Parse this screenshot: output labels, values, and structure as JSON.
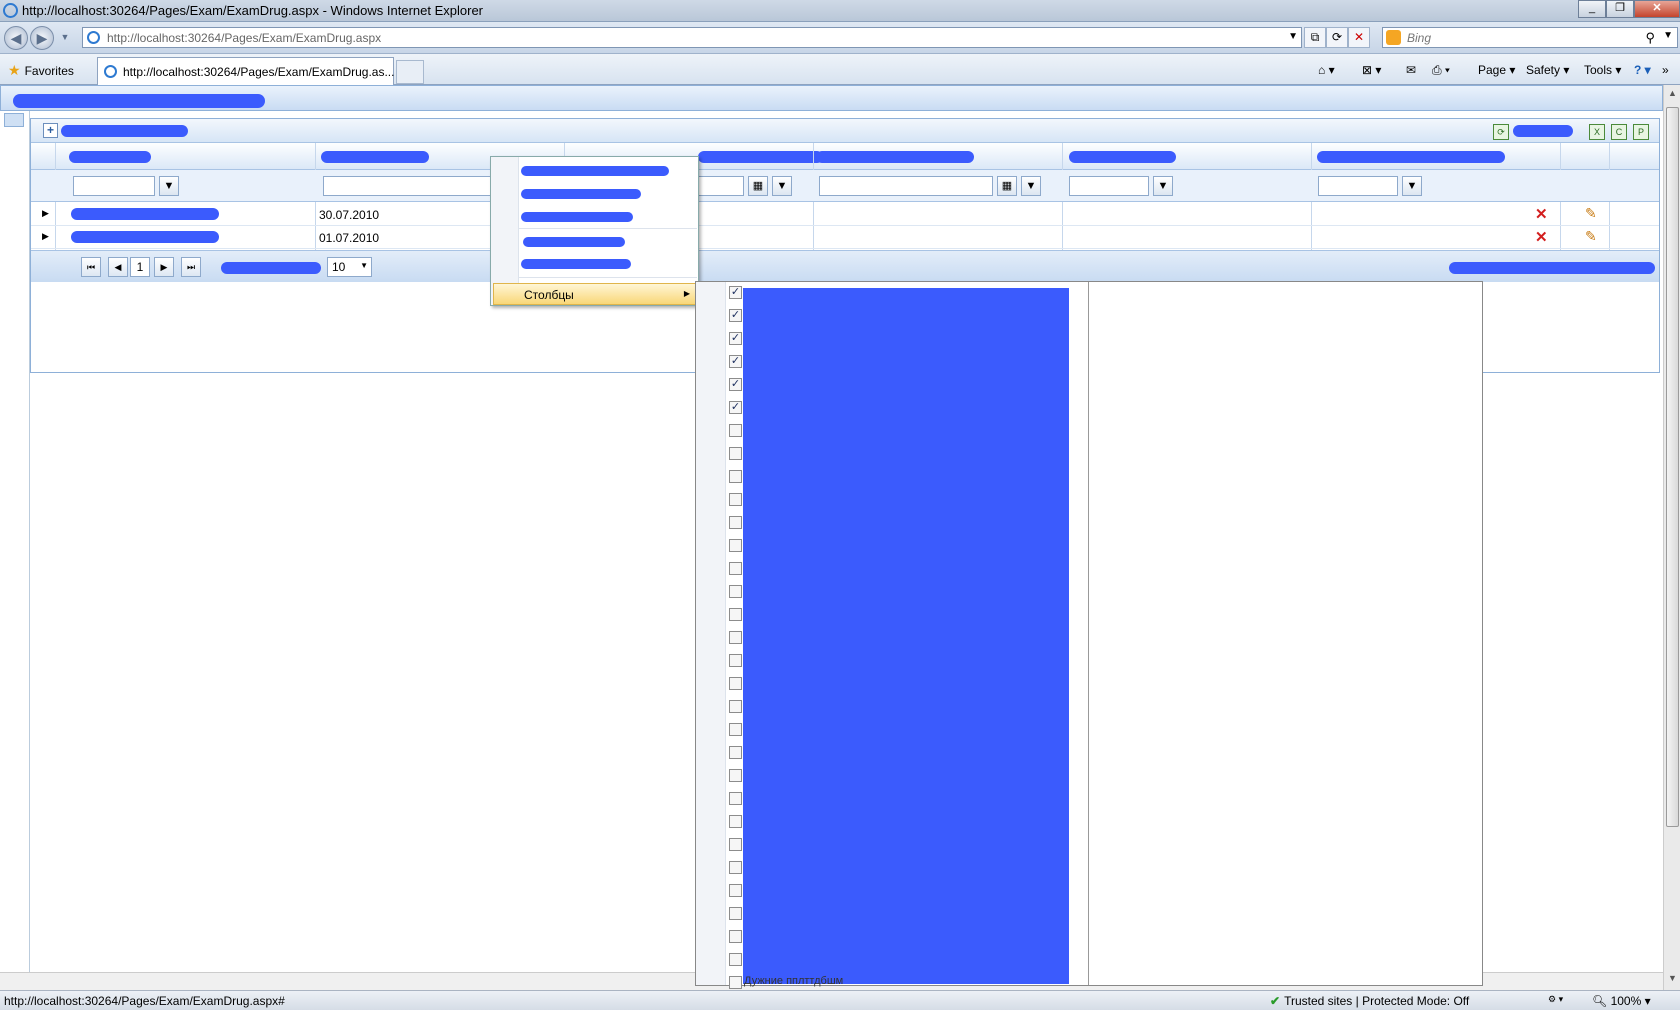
{
  "window": {
    "title": "http://localhost:30264/Pages/Exam/ExamDrug.aspx - Windows Internet Explorer"
  },
  "address": {
    "url": "http://localhost:30264/Pages/Exam/ExamDrug.aspx"
  },
  "search": {
    "placeholder": "Bing"
  },
  "favorites": {
    "label": "Favorites"
  },
  "tab": {
    "title": "http://localhost:30264/Pages/Exam/ExamDrug.as..."
  },
  "commands": {
    "page": "Page",
    "safety": "Safety",
    "tools": "Tools"
  },
  "grid": {
    "rows": [
      {
        "date": "30.07.2010"
      },
      {
        "date": "01.07.2010"
      }
    ],
    "pager": {
      "current_page": "1",
      "page_size": "10"
    }
  },
  "context_menu": {
    "columns_label": "Столбцы"
  },
  "columns_submenu": {
    "checked_states": [
      true,
      true,
      true,
      true,
      true,
      true,
      false,
      false,
      false,
      false,
      false,
      false,
      false,
      false,
      false,
      false,
      false,
      false,
      false,
      false,
      false,
      false,
      false,
      false,
      false,
      false,
      false,
      false,
      false,
      false,
      false,
      false
    ],
    "footer_text": "Дужние пплттдбшм"
  },
  "status": {
    "url": "http://localhost:30264/Pages/Exam/ExamDrug.aspx#",
    "zone": "Trusted sites | Protected Mode: Off",
    "zoom": "100%"
  }
}
